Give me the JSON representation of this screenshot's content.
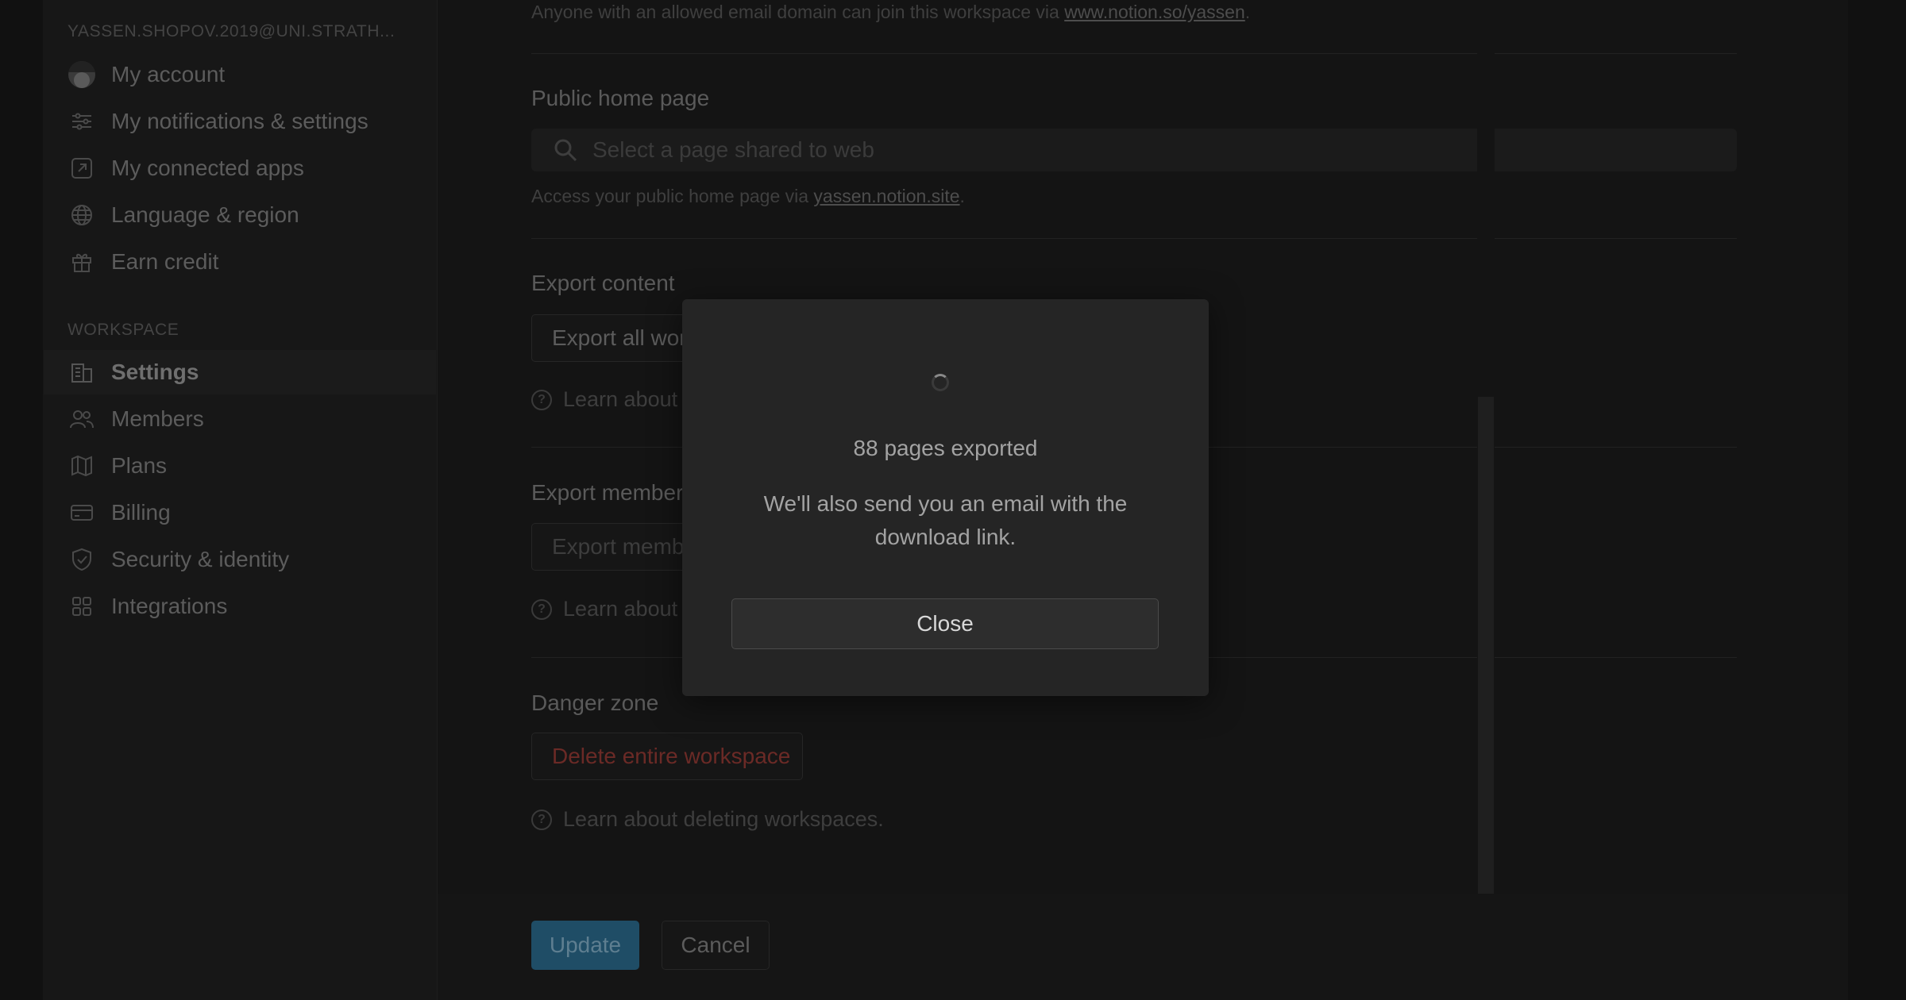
{
  "sidebar": {
    "account_label": "YASSEN.SHOPOV.2019@UNI.STRATH...",
    "account_items": [
      {
        "label": "My account"
      },
      {
        "label": "My notifications & settings"
      },
      {
        "label": "My connected apps"
      },
      {
        "label": "Language & region"
      },
      {
        "label": "Earn credit"
      }
    ],
    "workspace_label": "WORKSPACE",
    "workspace_items": [
      {
        "label": "Settings"
      },
      {
        "label": "Members"
      },
      {
        "label": "Plans"
      },
      {
        "label": "Billing"
      },
      {
        "label": "Security & identity"
      },
      {
        "label": "Integrations"
      }
    ]
  },
  "content": {
    "domain_note_prefix": "Anyone with an allowed email domain can join this workspace via ",
    "domain_note_link": "www.notion.so/yassen",
    "domain_note_suffix": ".",
    "public_home_heading": "Public home page",
    "public_home_search_placeholder": "Select a page shared to web",
    "public_home_caption_prefix": "Access your public home page via ",
    "public_home_caption_link": "yassen.notion.site",
    "public_home_caption_suffix": ".",
    "export_content_heading": "Export content",
    "export_content_button": "Export all wor",
    "export_content_learn": "Learn about",
    "export_members_heading": "Export member",
    "export_members_button": "Export memb",
    "export_members_learn": "Learn about",
    "danger_heading": "Danger zone",
    "delete_button": "Delete entire workspace",
    "delete_learn": "Learn about deleting workspaces."
  },
  "footer": {
    "update_label": "Update",
    "cancel_label": "Cancel"
  },
  "modal": {
    "title": "88 pages exported",
    "message": "We'll also send you an email with the download link.",
    "close_label": "Close"
  }
}
